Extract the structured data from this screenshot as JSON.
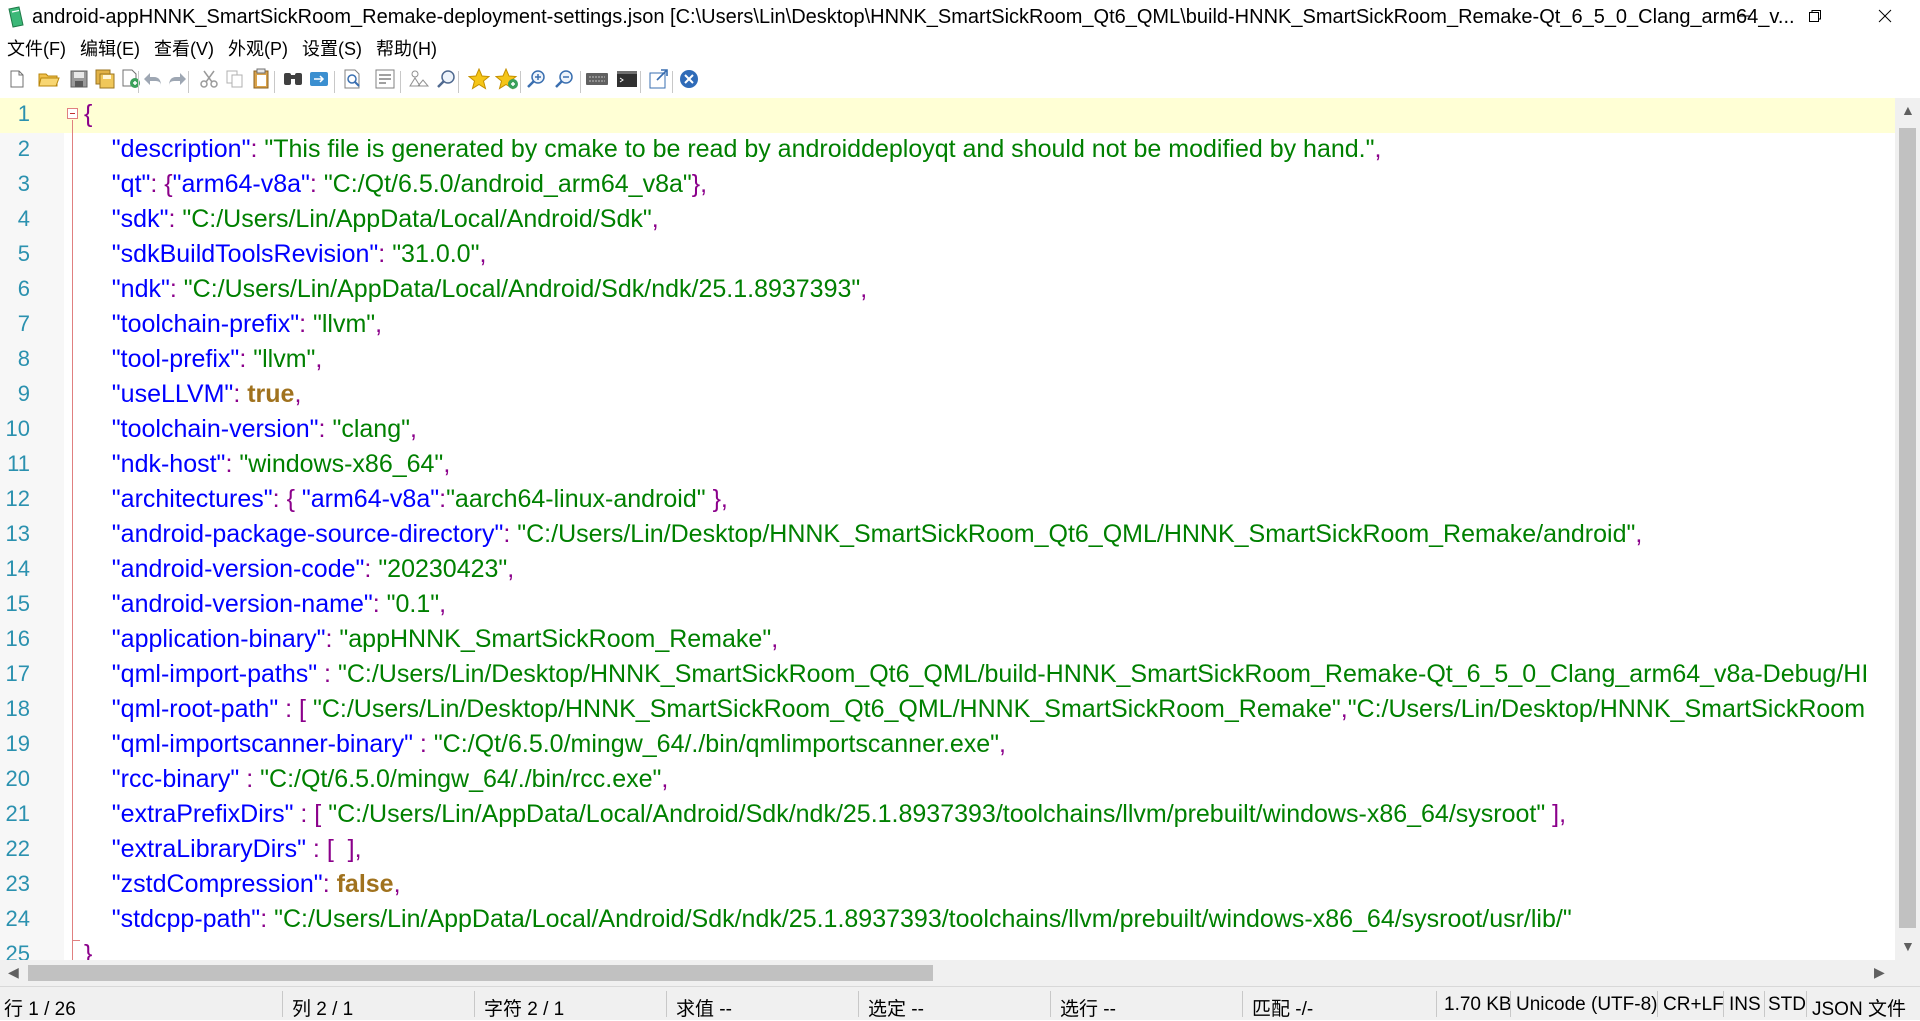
{
  "window": {
    "title": "android-appHNNK_SmartSickRoom_Remake-deployment-settings.json [C:\\Users\\Lin\\Desktop\\HNNK_SmartSickRoom_Qt6_QML\\build-HNNK_SmartSickRoom_Remake-Qt_6_5_0_Clang_arm64_v...",
    "controls": [
      "minimize-icon",
      "restore-icon",
      "close-icon"
    ]
  },
  "menu": [
    "文件(F)",
    "编辑(E)",
    "查看(V)",
    "外观(P)",
    "设置(S)",
    "帮助(H)"
  ],
  "toolbar": [
    "new-file-icon",
    "open-folder-icon",
    "save-icon",
    "save-all-icon",
    "reload-icon",
    "undo-icon",
    "redo-icon",
    "cut-icon",
    "copy-icon",
    "paste-icon",
    "find-icon",
    "replace-icon",
    "find-in-files-icon",
    "goto-line-icon",
    "word-wrap-icon",
    "zoom-find-icon",
    "favorite-icon",
    "add-favorite-icon",
    "zoom-in-icon",
    "zoom-out-icon",
    "keyboard-icon",
    "terminal-icon",
    "export-icon",
    "close-file-icon"
  ],
  "editor": {
    "lines": [
      {
        "n": "1",
        "tokens": [
          {
            "t": "{",
            "c": "p"
          }
        ]
      },
      {
        "n": "2",
        "tokens": [
          {
            "t": "    ",
            "c": ""
          },
          {
            "t": "\"description\"",
            "c": "k"
          },
          {
            "t": ": ",
            "c": "p"
          },
          {
            "t": "\"This file is generated by cmake to be read by androiddeployqt and should not be modified by hand.\"",
            "c": "s"
          },
          {
            "t": ",",
            "c": "p"
          }
        ]
      },
      {
        "n": "3",
        "tokens": [
          {
            "t": "    ",
            "c": ""
          },
          {
            "t": "\"qt\"",
            "c": "k"
          },
          {
            "t": ": {",
            "c": "p"
          },
          {
            "t": "\"arm64-v8a\"",
            "c": "k"
          },
          {
            "t": ": ",
            "c": "p"
          },
          {
            "t": "\"C:/Qt/6.5.0/android_arm64_v8a\"",
            "c": "s"
          },
          {
            "t": "},",
            "c": "p"
          }
        ]
      },
      {
        "n": "4",
        "tokens": [
          {
            "t": "    ",
            "c": ""
          },
          {
            "t": "\"sdk\"",
            "c": "k"
          },
          {
            "t": ": ",
            "c": "p"
          },
          {
            "t": "\"C:/Users/Lin/AppData/Local/Android/Sdk\"",
            "c": "s"
          },
          {
            "t": ",",
            "c": "p"
          }
        ]
      },
      {
        "n": "5",
        "tokens": [
          {
            "t": "    ",
            "c": ""
          },
          {
            "t": "\"sdkBuildToolsRevision\"",
            "c": "k"
          },
          {
            "t": ": ",
            "c": "p"
          },
          {
            "t": "\"31.0.0\"",
            "c": "s"
          },
          {
            "t": ",",
            "c": "p"
          }
        ]
      },
      {
        "n": "6",
        "tokens": [
          {
            "t": "    ",
            "c": ""
          },
          {
            "t": "\"ndk\"",
            "c": "k"
          },
          {
            "t": ": ",
            "c": "p"
          },
          {
            "t": "\"C:/Users/Lin/AppData/Local/Android/Sdk/ndk/25.1.8937393\"",
            "c": "s"
          },
          {
            "t": ",",
            "c": "p"
          }
        ]
      },
      {
        "n": "7",
        "tokens": [
          {
            "t": "    ",
            "c": ""
          },
          {
            "t": "\"toolchain-prefix\"",
            "c": "k"
          },
          {
            "t": ": ",
            "c": "p"
          },
          {
            "t": "\"llvm\"",
            "c": "s"
          },
          {
            "t": ",",
            "c": "p"
          }
        ]
      },
      {
        "n": "8",
        "tokens": [
          {
            "t": "    ",
            "c": ""
          },
          {
            "t": "\"tool-prefix\"",
            "c": "k"
          },
          {
            "t": ": ",
            "c": "p"
          },
          {
            "t": "\"llvm\"",
            "c": "s"
          },
          {
            "t": ",",
            "c": "p"
          }
        ]
      },
      {
        "n": "9",
        "tokens": [
          {
            "t": "    ",
            "c": ""
          },
          {
            "t": "\"useLLVM\"",
            "c": "k"
          },
          {
            "t": ": ",
            "c": "p"
          },
          {
            "t": "true",
            "c": "b"
          },
          {
            "t": ",",
            "c": "p"
          }
        ]
      },
      {
        "n": "10",
        "tokens": [
          {
            "t": "    ",
            "c": ""
          },
          {
            "t": "\"toolchain-version\"",
            "c": "k"
          },
          {
            "t": ": ",
            "c": "p"
          },
          {
            "t": "\"clang\"",
            "c": "s"
          },
          {
            "t": ",",
            "c": "p"
          }
        ]
      },
      {
        "n": "11",
        "tokens": [
          {
            "t": "    ",
            "c": ""
          },
          {
            "t": "\"ndk-host\"",
            "c": "k"
          },
          {
            "t": ": ",
            "c": "p"
          },
          {
            "t": "\"windows-x86_64\"",
            "c": "s"
          },
          {
            "t": ",",
            "c": "p"
          }
        ]
      },
      {
        "n": "12",
        "tokens": [
          {
            "t": "    ",
            "c": ""
          },
          {
            "t": "\"architectures\"",
            "c": "k"
          },
          {
            "t": ": { ",
            "c": "p"
          },
          {
            "t": "\"arm64-v8a\"",
            "c": "k"
          },
          {
            "t": ":",
            "c": "p"
          },
          {
            "t": "\"aarch64-linux-android\"",
            "c": "s"
          },
          {
            "t": " },",
            "c": "p"
          }
        ]
      },
      {
        "n": "13",
        "tokens": [
          {
            "t": "    ",
            "c": ""
          },
          {
            "t": "\"android-package-source-directory\"",
            "c": "k"
          },
          {
            "t": ": ",
            "c": "p"
          },
          {
            "t": "\"C:/Users/Lin/Desktop/HNNK_SmartSickRoom_Qt6_QML/HNNK_SmartSickRoom_Remake/android\"",
            "c": "s"
          },
          {
            "t": ",",
            "c": "p"
          }
        ]
      },
      {
        "n": "14",
        "tokens": [
          {
            "t": "    ",
            "c": ""
          },
          {
            "t": "\"android-version-code\"",
            "c": "k"
          },
          {
            "t": ": ",
            "c": "p"
          },
          {
            "t": "\"20230423\"",
            "c": "s"
          },
          {
            "t": ",",
            "c": "p"
          }
        ]
      },
      {
        "n": "15",
        "tokens": [
          {
            "t": "    ",
            "c": ""
          },
          {
            "t": "\"android-version-name\"",
            "c": "k"
          },
          {
            "t": ": ",
            "c": "p"
          },
          {
            "t": "\"0.1\"",
            "c": "s"
          },
          {
            "t": ",",
            "c": "p"
          }
        ]
      },
      {
        "n": "16",
        "tokens": [
          {
            "t": "    ",
            "c": ""
          },
          {
            "t": "\"application-binary\"",
            "c": "k"
          },
          {
            "t": ": ",
            "c": "p"
          },
          {
            "t": "\"appHNNK_SmartSickRoom_Remake\"",
            "c": "s"
          },
          {
            "t": ",",
            "c": "p"
          }
        ]
      },
      {
        "n": "17",
        "tokens": [
          {
            "t": "    ",
            "c": ""
          },
          {
            "t": "\"qml-import-paths\"",
            "c": "k"
          },
          {
            "t": " : ",
            "c": "p"
          },
          {
            "t": "\"C:/Users/Lin/Desktop/HNNK_SmartSickRoom_Qt6_QML/build-HNNK_SmartSickRoom_Remake-Qt_6_5_0_Clang_arm64_v8a-Debug/HI",
            "c": "s"
          }
        ]
      },
      {
        "n": "18",
        "tokens": [
          {
            "t": "    ",
            "c": ""
          },
          {
            "t": "\"qml-root-path\"",
            "c": "k"
          },
          {
            "t": " : [ ",
            "c": "p"
          },
          {
            "t": "\"C:/Users/Lin/Desktop/HNNK_SmartSickRoom_Qt6_QML/HNNK_SmartSickRoom_Remake\"",
            "c": "s"
          },
          {
            "t": ",",
            "c": "p"
          },
          {
            "t": "\"C:/Users/Lin/Desktop/HNNK_SmartSickRoom",
            "c": "s"
          }
        ]
      },
      {
        "n": "19",
        "tokens": [
          {
            "t": "    ",
            "c": ""
          },
          {
            "t": "\"qml-importscanner-binary\"",
            "c": "k"
          },
          {
            "t": " : ",
            "c": "p"
          },
          {
            "t": "\"C:/Qt/6.5.0/mingw_64/./bin/qmlimportscanner.exe\"",
            "c": "s"
          },
          {
            "t": ",",
            "c": "p"
          }
        ]
      },
      {
        "n": "20",
        "tokens": [
          {
            "t": "    ",
            "c": ""
          },
          {
            "t": "\"rcc-binary\"",
            "c": "k"
          },
          {
            "t": " : ",
            "c": "p"
          },
          {
            "t": "\"C:/Qt/6.5.0/mingw_64/./bin/rcc.exe\"",
            "c": "s"
          },
          {
            "t": ",",
            "c": "p"
          }
        ]
      },
      {
        "n": "21",
        "tokens": [
          {
            "t": "    ",
            "c": ""
          },
          {
            "t": "\"extraPrefixDirs\"",
            "c": "k"
          },
          {
            "t": " : [ ",
            "c": "p"
          },
          {
            "t": "\"C:/Users/Lin/AppData/Local/Android/Sdk/ndk/25.1.8937393/toolchains/llvm/prebuilt/windows-x86_64/sysroot\"",
            "c": "s"
          },
          {
            "t": " ],",
            "c": "p"
          }
        ]
      },
      {
        "n": "22",
        "tokens": [
          {
            "t": "    ",
            "c": ""
          },
          {
            "t": "\"extraLibraryDirs\"",
            "c": "k"
          },
          {
            "t": " : [  ],",
            "c": "p"
          }
        ]
      },
      {
        "n": "23",
        "tokens": [
          {
            "t": "    ",
            "c": ""
          },
          {
            "t": "\"zstdCompression\"",
            "c": "k"
          },
          {
            "t": ": ",
            "c": "p"
          },
          {
            "t": "false",
            "c": "b"
          },
          {
            "t": ",",
            "c": "p"
          }
        ]
      },
      {
        "n": "24",
        "tokens": [
          {
            "t": "    ",
            "c": ""
          },
          {
            "t": "\"stdcpp-path\"",
            "c": "k"
          },
          {
            "t": ": ",
            "c": "p"
          },
          {
            "t": "\"C:/Users/Lin/AppData/Local/Android/Sdk/ndk/25.1.8937393/toolchains/llvm/prebuilt/windows-x86_64/sysroot/usr/lib/\"",
            "c": "s"
          }
        ]
      },
      {
        "n": "25",
        "tokens": [
          {
            "t": "}",
            "c": "p"
          }
        ]
      }
    ]
  },
  "status": {
    "line": "行  1 / 26",
    "col": "列  2 / 1",
    "chars": "字符  2 / 1",
    "sum": "求值  --",
    "selected": "选定  --",
    "selected_lines": "选行  --",
    "match": "匹配  -/-",
    "size": "1.70 KB",
    "encoding": "Unicode (UTF-8)",
    "eol": "CR+LF",
    "ins": "INS",
    "std": "STD",
    "filetype": "JSON 文件"
  }
}
